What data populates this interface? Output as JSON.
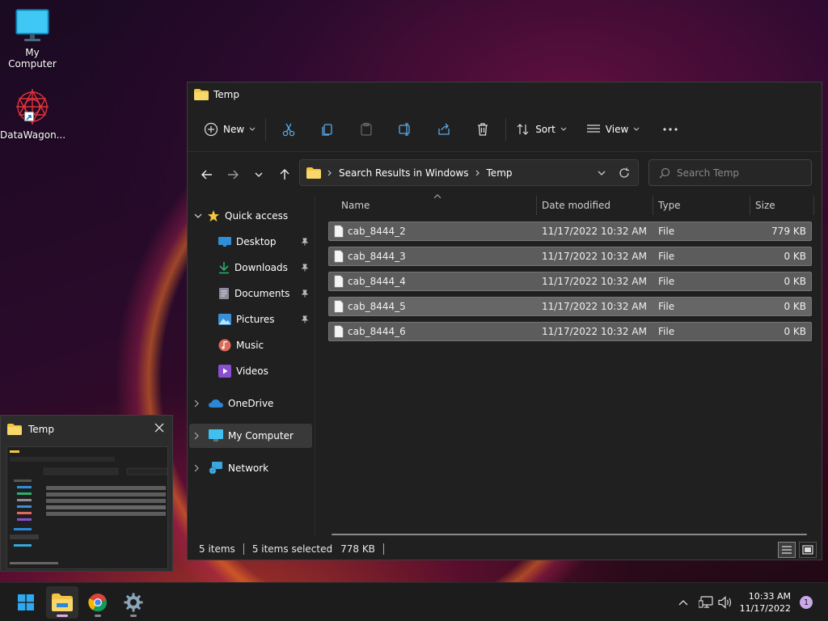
{
  "desktop": {
    "icons": [
      {
        "label": "My Computer"
      },
      {
        "label": "DataWagon..."
      }
    ]
  },
  "explorer": {
    "title": "Temp",
    "toolbar": {
      "new_label": "New",
      "sort_label": "Sort",
      "view_label": "View"
    },
    "address": {
      "crumbs": [
        "Search Results in Windows",
        "Temp"
      ]
    },
    "search": {
      "placeholder": "Search Temp"
    },
    "sidebar": {
      "quick_access": "Quick access",
      "items": [
        {
          "label": "Desktop",
          "pinned": true
        },
        {
          "label": "Downloads",
          "pinned": true
        },
        {
          "label": "Documents",
          "pinned": true
        },
        {
          "label": "Pictures",
          "pinned": true
        },
        {
          "label": "Music",
          "pinned": false
        },
        {
          "label": "Videos",
          "pinned": false
        }
      ],
      "onedrive": "OneDrive",
      "my_computer": "My Computer",
      "network": "Network"
    },
    "columns": {
      "name": "Name",
      "date": "Date modified",
      "type": "Type",
      "size": "Size"
    },
    "files": [
      {
        "name": "cab_8444_2",
        "date": "11/17/2022 10:32 AM",
        "type": "File",
        "size": "779 KB"
      },
      {
        "name": "cab_8444_3",
        "date": "11/17/2022 10:32 AM",
        "type": "File",
        "size": "0 KB"
      },
      {
        "name": "cab_8444_4",
        "date": "11/17/2022 10:32 AM",
        "type": "File",
        "size": "0 KB"
      },
      {
        "name": "cab_8444_5",
        "date": "11/17/2022 10:32 AM",
        "type": "File",
        "size": "0 KB"
      },
      {
        "name": "cab_8444_6",
        "date": "11/17/2022 10:32 AM",
        "type": "File",
        "size": "0 KB"
      }
    ],
    "status": {
      "count": "5 items",
      "selected": "5 items selected",
      "selected_size": "778 KB"
    }
  },
  "thumbnail": {
    "title": "Temp"
  },
  "taskbar": {
    "clock_time": "10:33 AM",
    "clock_date": "11/17/2022",
    "notification_count": "1"
  },
  "colors": {
    "accent": "#0078d4",
    "folder": "#f4c542",
    "selection": "#5c5c5c"
  }
}
